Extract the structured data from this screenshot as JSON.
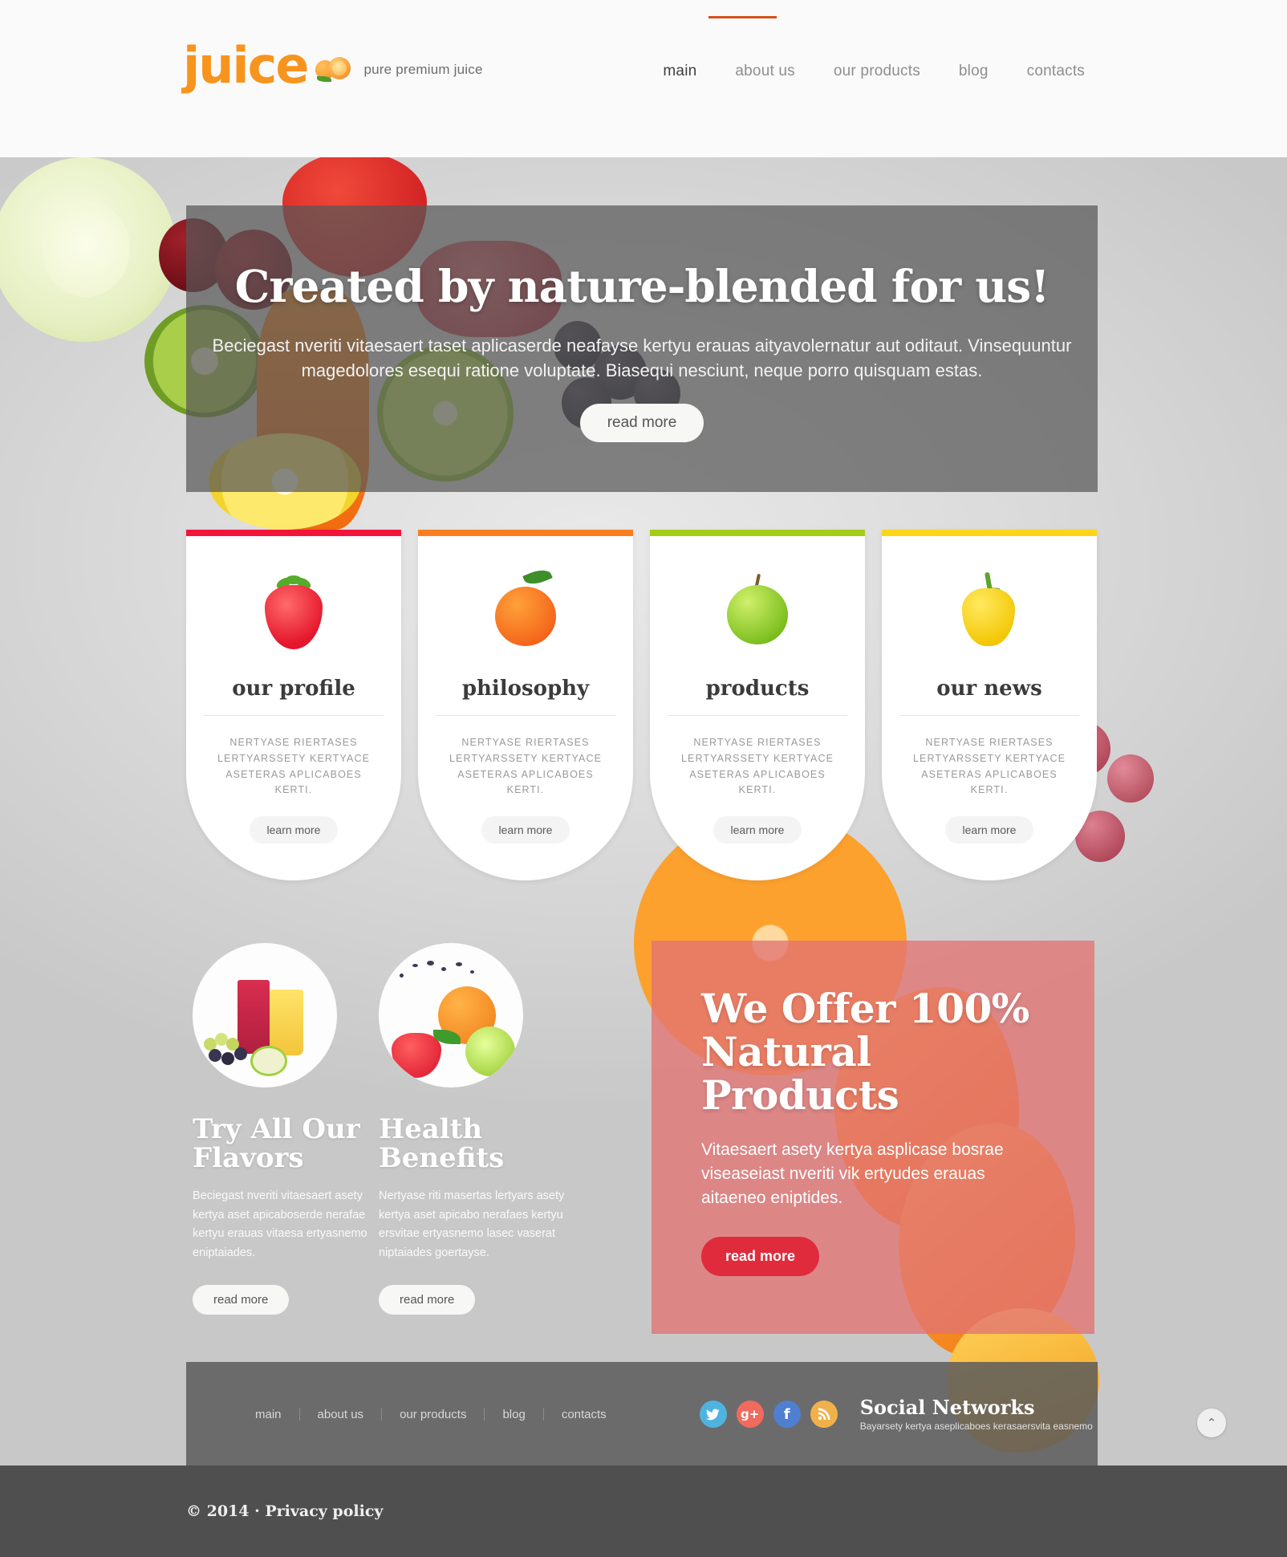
{
  "header": {
    "logo_word": "juice",
    "tagline": "pure premium juice",
    "nav": [
      {
        "label": "main",
        "active": true
      },
      {
        "label": "about us",
        "active": false
      },
      {
        "label": "our products",
        "active": false
      },
      {
        "label": "blog",
        "active": false
      },
      {
        "label": "contacts",
        "active": false
      }
    ]
  },
  "hero": {
    "title": "Created by nature-blended for us!",
    "paragraph": "Beciegast nveriti vitaesaert taset aplicaserde neafayse kertyu erauas aityavolernatur aut oditaut. Vinsequuntur magedolores esequi ratione voluptate. Biasequi nesciunt, neque porro quisquam estas.",
    "button": "read more"
  },
  "cards": [
    {
      "title": "our profile",
      "desc": "NERTYASE RIERTASES LERTYARSSETY KERTYACE ASETERAS APLICABOES KERTI.",
      "button": "learn more",
      "bar_color": "#f4143b",
      "icon": "strawberry-icon"
    },
    {
      "title": "philosophy",
      "desc": "NERTYASE RIERTASES LERTYARSSETY KERTYACE ASETERAS APLICABOES KERTI.",
      "button": "learn more",
      "bar_color": "#fa7e1e",
      "icon": "tangerine-icon"
    },
    {
      "title": "products",
      "desc": "NERTYASE RIERTASES LERTYARSSETY KERTYACE ASETERAS APLICABOES KERTI.",
      "button": "learn more",
      "bar_color": "#a4cd15",
      "icon": "green-apple-icon"
    },
    {
      "title": "our news",
      "desc": "NERTYASE RIERTASES LERTYARSSETY KERTYACE ASETERAS APLICABOES KERTI.",
      "button": "learn more",
      "bar_color": "#fcd518",
      "icon": "yellow-pepper-icon"
    }
  ],
  "columns": [
    {
      "title": "Try All Our Flavors",
      "text": "Beciegast nveriti vitaesaert asety kertya aset apicaboserde nerafae kertyu erauas vitaesa ertyasnemo eniptaiades.",
      "button": "read more",
      "image": "juice-glasses-grapes-apple-photo"
    },
    {
      "title": "Health Benefits",
      "text": "Nertyase riti masertas lertyars asety kertya aset apicabo nerafaes kertyu ersvitae ertyasnemo lasec vaserat niptaiades goertayse.",
      "button": "read more",
      "image": "orange-lime-strawberry-splash-photo"
    }
  ],
  "promo": {
    "title": "We Offer 100% Natural Products",
    "text": "Vitaesaert asety kertya asplicase bosrae viseaseiast nveriti vik ertyudes erauas aitaeneo eniptides.",
    "button": "read more",
    "bg_color": "#e17373",
    "button_color": "#e02b3c"
  },
  "footer": {
    "nav": [
      "main",
      "about us",
      "our products",
      "blog",
      "contacts"
    ],
    "socials": [
      {
        "name": "twitter-icon",
        "glyph": "t",
        "color": "#4fb3e0"
      },
      {
        "name": "google-plus-icon",
        "glyph": "g+",
        "color": "#f06a5d"
      },
      {
        "name": "facebook-icon",
        "glyph": "f",
        "color": "#4f7fd0"
      },
      {
        "name": "rss-icon",
        "glyph": "◔",
        "color": "#f0b04a"
      }
    ],
    "social_title": "Social Networks",
    "social_sub": "Bayarsety kertya aseplicaboes kerasaersvita easnemo",
    "to_top": "⌃"
  },
  "copyright": {
    "text": "© 2014 · ",
    "link": "Privacy policy"
  }
}
